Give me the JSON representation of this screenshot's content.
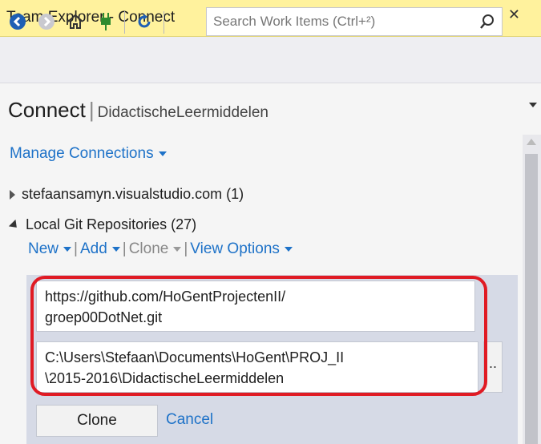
{
  "window": {
    "title": "Team Explorer - Connect",
    "controls": [
      "▾",
      "ᛘ",
      "✕"
    ]
  },
  "toolbar": {
    "buttons": [
      "back-icon",
      "forward-icon",
      "home-icon",
      "connect-icon",
      "refresh-icon"
    ],
    "search_placeholder": "Search Work Items (Ctrl+²)"
  },
  "header": {
    "title": "Connect",
    "separator": "|",
    "project": "DidactischeLeermiddelen"
  },
  "manage_connections": "Manage Connections",
  "tree": {
    "server": "stefaansamyn.visualstudio.com (1)",
    "local_repos": "Local Git Repositories (27)"
  },
  "actions": {
    "new": "New",
    "add": "Add",
    "clone": "Clone",
    "view_options": "View Options",
    "separator": "|"
  },
  "clone_form": {
    "url_value": "https://github.com/HoGentProjectenII/\ngroep00DotNet.git",
    "path_value": "C:\\Users\\Stefaan\\Documents\\HoGent\\PROJ_II\n\\2015-2016\\DidactischeLeermiddelen",
    "browse_label": "..",
    "clone_button": "Clone",
    "cancel_link": "Cancel"
  },
  "colors": {
    "title_bar": "#fff29d",
    "link": "#1e72c8",
    "panel": "#d6dae6",
    "highlight": "#e01b24"
  }
}
